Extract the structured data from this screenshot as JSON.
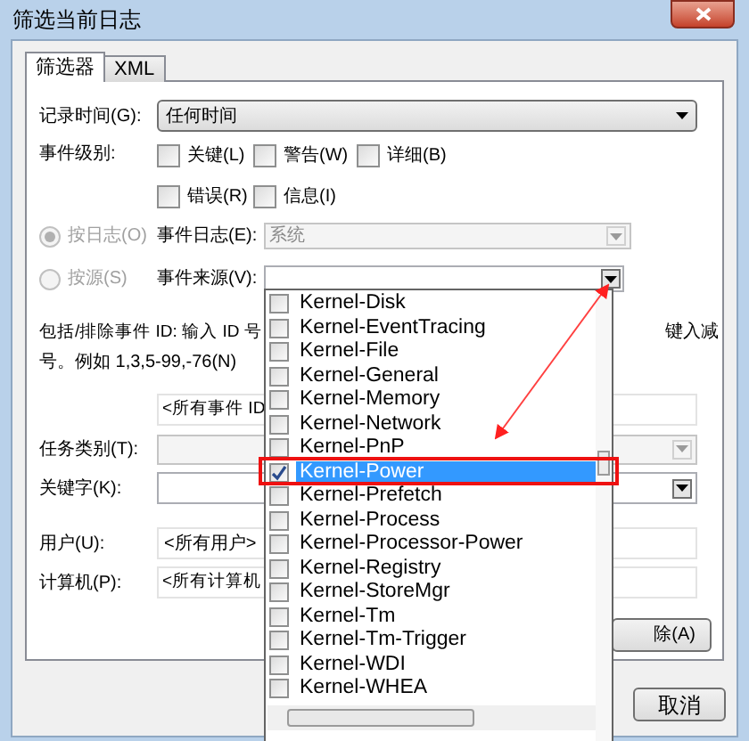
{
  "window": {
    "title": "筛选当前日志"
  },
  "tabs": [
    {
      "label": "筛选器",
      "selected": true
    },
    {
      "label": "XML",
      "selected": false
    }
  ],
  "logged": {
    "label": "记录时间(G):",
    "value": "任何时间"
  },
  "event_level": {
    "label": "事件级别:",
    "options": [
      {
        "label": "关键(L)",
        "checked": false
      },
      {
        "label": "警告(W)",
        "checked": false
      },
      {
        "label": "详细(B)",
        "checked": false
      },
      {
        "label": "错误(R)",
        "checked": false
      },
      {
        "label": "信息(I)",
        "checked": false
      }
    ]
  },
  "source_mode": [
    {
      "label": "按日志(O)",
      "selected": true,
      "disabled": true
    },
    {
      "label": "按源(S)",
      "selected": false,
      "disabled": true
    }
  ],
  "event_log": {
    "label": "事件日志(E):",
    "value": "系统",
    "disabled": true
  },
  "event_source": {
    "label": "事件来源(V):",
    "options": [
      {
        "label": "Kernel-Disk",
        "checked": false,
        "selected": false
      },
      {
        "label": "Kernel-EventTracing",
        "checked": false,
        "selected": false
      },
      {
        "label": "Kernel-File",
        "checked": false,
        "selected": false
      },
      {
        "label": "Kernel-General",
        "checked": false,
        "selected": false
      },
      {
        "label": "Kernel-Memory",
        "checked": false,
        "selected": false
      },
      {
        "label": "Kernel-Network",
        "checked": false,
        "selected": false
      },
      {
        "label": "Kernel-PnP",
        "checked": false,
        "selected": false
      },
      {
        "label": "Kernel-Power",
        "checked": true,
        "selected": true
      },
      {
        "label": "Kernel-Prefetch",
        "checked": false,
        "selected": false
      },
      {
        "label": "Kernel-Process",
        "checked": false,
        "selected": false
      },
      {
        "label": "Kernel-Processor-Power",
        "checked": false,
        "selected": false
      },
      {
        "label": "Kernel-Registry",
        "checked": false,
        "selected": false
      },
      {
        "label": "Kernel-StoreMgr",
        "checked": false,
        "selected": false
      },
      {
        "label": "Kernel-Tm",
        "checked": false,
        "selected": false
      },
      {
        "label": "Kernel-Tm-Trigger",
        "checked": false,
        "selected": false
      },
      {
        "label": "Kernel-WDI",
        "checked": false,
        "selected": false
      },
      {
        "label": "Kernel-WHEA",
        "checked": false,
        "selected": false
      }
    ]
  },
  "id_hint": {
    "line_1_left": "包括/排除事件 ID: 输入 ID 号",
    "line_1_right": "键入减",
    "line_2": "号。例如 1,3,5-99,-76(N)"
  },
  "event_id": {
    "value": "<所有事件 ID"
  },
  "task_category": {
    "label": "任务类别(T):",
    "disabled": true
  },
  "keywords": {
    "label": "关键字(K):"
  },
  "user": {
    "label": "用户(U):",
    "value": "<所有用户>"
  },
  "computer": {
    "label": "计算机(P):",
    "value": "<所有计算机"
  },
  "clear_button": "除(A)",
  "cancel_button": "取消"
}
